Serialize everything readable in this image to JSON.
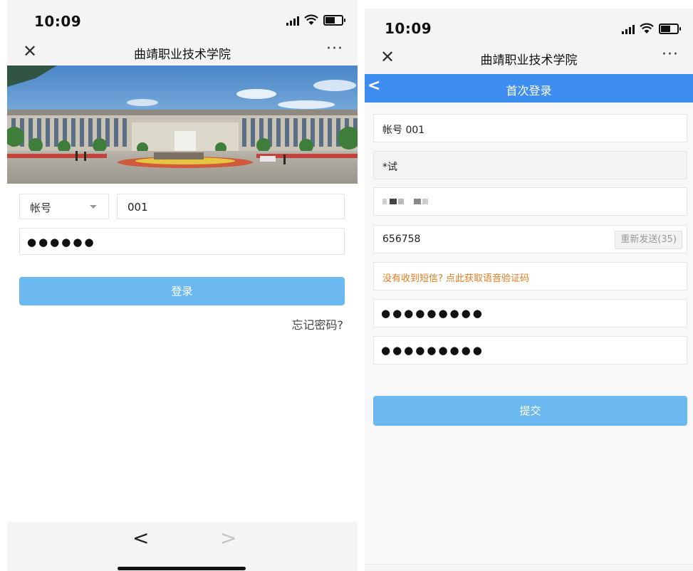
{
  "status": {
    "time": "10:09"
  },
  "app": {
    "title": "曲靖职业技术学院",
    "close_glyph": "✕",
    "more_glyph": "···"
  },
  "login": {
    "account_type": "帐号",
    "account_value": "001",
    "password_dots": "●●●●●●",
    "login_button": "登录",
    "forgot_link": "忘记密码?"
  },
  "browser_nav": {
    "back_glyph": "<",
    "forward_glyph": ">"
  },
  "first_login": {
    "header_title": "首次登录",
    "back_glyph": "<",
    "account": "帐号 001",
    "name": "*试",
    "sms_code": "656758",
    "resend_label": "重新发送(35)",
    "voice_code_link": "没有收到短信? 点此获取语音验证码",
    "new_password_dots": "●●●●●●●●●",
    "confirm_password_dots": "●●●●●●●●●",
    "submit_button": "提交"
  },
  "colors": {
    "primary_button": "#6cb8f0",
    "header_blue": "#3d8ef0",
    "link_orange": "#e07b1f"
  },
  "icons": [
    "close-icon",
    "more-icon",
    "signal-icon",
    "wifi-icon",
    "battery-icon",
    "dropdown-arrow-icon",
    "back-chevron-icon",
    "forward-chevron-icon"
  ]
}
